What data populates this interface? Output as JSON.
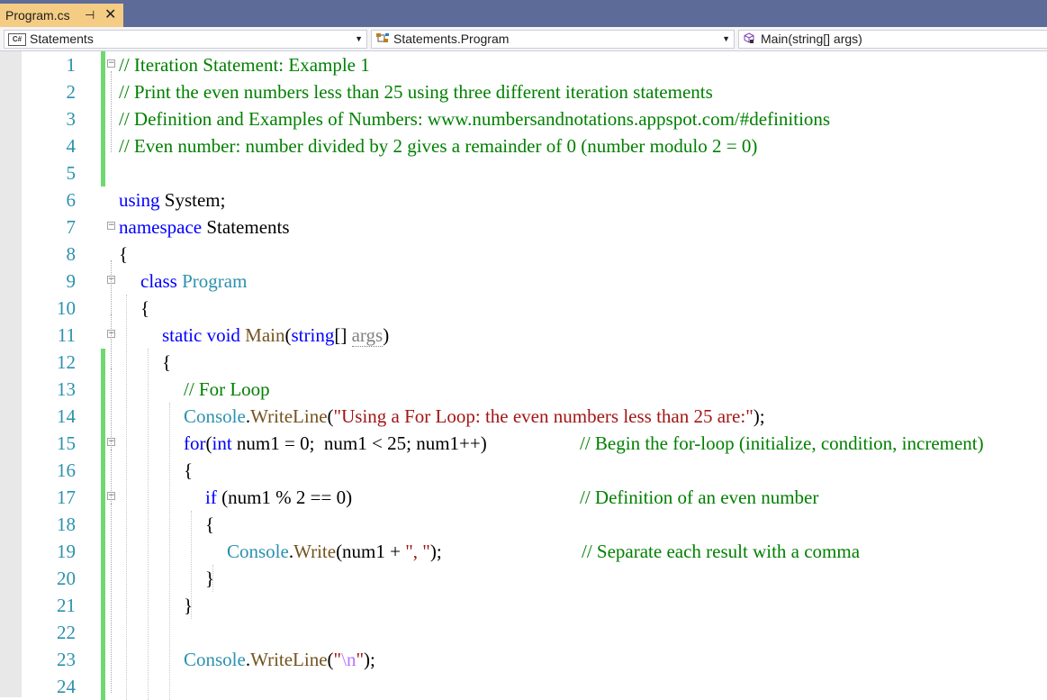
{
  "tab": {
    "title": "Program.cs",
    "pin": "⊣",
    "close": "✕"
  },
  "nav": {
    "project": "Statements",
    "project_icon": "C#",
    "class": "Statements.Program",
    "member": "Main(string[] args)"
  },
  "lines": [
    {
      "n": "1",
      "indent": 0,
      "segs": [
        [
          "c-com",
          "// Iteration Statement: Example 1"
        ]
      ]
    },
    {
      "n": "2",
      "indent": 0,
      "segs": [
        [
          "c-com",
          "// Print the even numbers less than 25 using three different iteration statements"
        ]
      ]
    },
    {
      "n": "3",
      "indent": 0,
      "segs": [
        [
          "c-com",
          "// Definition and Examples of Numbers: www.numbersandnotations.appspot.com/#definitions"
        ]
      ]
    },
    {
      "n": "4",
      "indent": 0,
      "segs": [
        [
          "c-com",
          "// Even number: number divided by 2 gives a remainder of 0 (number modulo 2 = 0)"
        ]
      ]
    },
    {
      "n": "5",
      "indent": 0,
      "segs": []
    },
    {
      "n": "6",
      "indent": 0,
      "segs": [
        [
          "c-kw",
          "using"
        ],
        [
          "",
          " System;"
        ]
      ]
    },
    {
      "n": "7",
      "indent": 0,
      "segs": [
        [
          "c-kw",
          "namespace"
        ],
        [
          "",
          " Statements"
        ]
      ]
    },
    {
      "n": "8",
      "indent": 0,
      "segs": [
        [
          "",
          "{"
        ]
      ]
    },
    {
      "n": "9",
      "indent": 1,
      "segs": [
        [
          "c-kw",
          "class"
        ],
        [
          "",
          " "
        ],
        [
          "c-type",
          "Program"
        ]
      ]
    },
    {
      "n": "10",
      "indent": 1,
      "segs": [
        [
          "",
          "{"
        ]
      ]
    },
    {
      "n": "11",
      "indent": 2,
      "segs": [
        [
          "c-kw",
          "static"
        ],
        [
          "",
          " "
        ],
        [
          "c-kw",
          "void"
        ],
        [
          "",
          " "
        ],
        [
          "c-meth",
          "Main"
        ],
        [
          "",
          "("
        ],
        [
          "c-kw",
          "string"
        ],
        [
          "",
          "[] "
        ],
        [
          "c-par",
          "args"
        ],
        [
          "",
          ")"
        ]
      ]
    },
    {
      "n": "12",
      "indent": 2,
      "segs": [
        [
          "",
          "{"
        ]
      ]
    },
    {
      "n": "13",
      "indent": 3,
      "segs": [
        [
          "c-com",
          "// For Loop"
        ]
      ]
    },
    {
      "n": "14",
      "indent": 3,
      "segs": [
        [
          "c-type",
          "Console"
        ],
        [
          "",
          "."
        ],
        [
          "c-meth",
          "WriteLine"
        ],
        [
          "",
          "("
        ],
        [
          "c-str",
          "\"Using a For Loop: the even numbers less than 25 are:\""
        ],
        [
          "",
          ");"
        ]
      ]
    },
    {
      "n": "15",
      "indent": 3,
      "segs": [
        [
          "c-kw",
          "for"
        ],
        [
          "",
          "("
        ],
        [
          "c-kw",
          "int"
        ],
        [
          "",
          " num1 = 0;  num1 < 25; num1++)"
        ]
      ],
      "comment": "// Begin the for-loop (initialize, condition, increment)"
    },
    {
      "n": "16",
      "indent": 3,
      "segs": [
        [
          "",
          "{"
        ]
      ]
    },
    {
      "n": "17",
      "indent": 4,
      "segs": [
        [
          "c-kw",
          "if"
        ],
        [
          "",
          " (num1 % 2 == 0)"
        ]
      ],
      "comment": "// Definition of an even number"
    },
    {
      "n": "18",
      "indent": 4,
      "segs": [
        [
          "",
          "{"
        ]
      ]
    },
    {
      "n": "19",
      "indent": 5,
      "segs": [
        [
          "c-type",
          "Console"
        ],
        [
          "",
          "."
        ],
        [
          "c-meth",
          "Write"
        ],
        [
          "",
          "(num1 + "
        ],
        [
          "c-str",
          "\", \""
        ],
        [
          "",
          ");"
        ]
      ],
      "comment": "// Separate each result with a comma"
    },
    {
      "n": "20",
      "indent": 4,
      "segs": [
        [
          "",
          "}"
        ]
      ]
    },
    {
      "n": "21",
      "indent": 3,
      "segs": [
        [
          "",
          "}"
        ]
      ]
    },
    {
      "n": "22",
      "indent": 3,
      "segs": []
    },
    {
      "n": "23",
      "indent": 3,
      "segs": [
        [
          "c-type",
          "Console"
        ],
        [
          "",
          "."
        ],
        [
          "c-meth",
          "WriteLine"
        ],
        [
          "",
          "("
        ],
        [
          "c-str",
          "\""
        ],
        [
          "c-esc",
          "\\n"
        ],
        [
          "c-str",
          "\""
        ],
        [
          "",
          ");"
        ]
      ]
    },
    {
      "n": "24",
      "indent": 3,
      "segs": []
    }
  ],
  "colors": {
    "comment": "#008000",
    "keyword": "#0000ff",
    "type": "#2b91af",
    "method": "#74531f",
    "string": "#a31515",
    "change_margin": "#6fd96f",
    "tab_active": "#f5cc84",
    "tab_bar": "#5d6b99"
  }
}
